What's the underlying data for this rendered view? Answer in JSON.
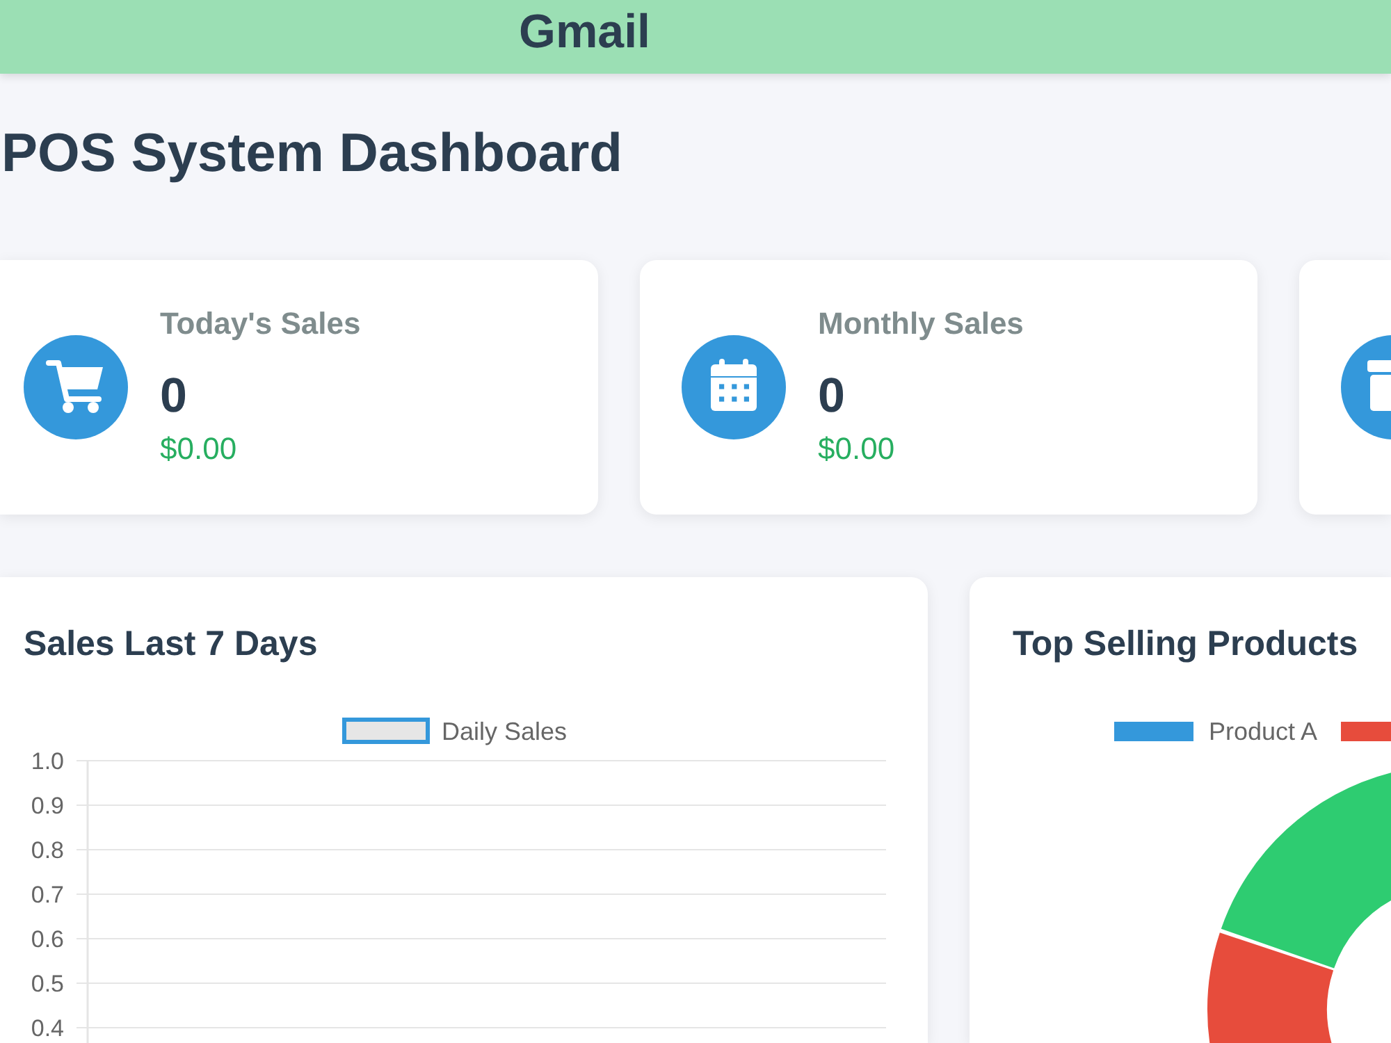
{
  "header": {
    "title": "Gmail"
  },
  "page_title": "POS System Dashboard",
  "stats": [
    {
      "kind": "cart",
      "label": "Today's Sales",
      "count": "0",
      "amount": "$0.00"
    },
    {
      "kind": "calendar",
      "label": "Monthly Sales",
      "count": "0",
      "amount": "$0.00"
    },
    {
      "kind": "box"
    }
  ],
  "sales_chart": {
    "title": "Sales Last 7 Days",
    "chart_data": {
      "type": "line",
      "series": [
        {
          "name": "Daily Sales",
          "color": "#3498db"
        }
      ],
      "ylim": [
        0.4,
        1
      ],
      "yticks": [
        {
          "value": 1,
          "label": "1.0"
        },
        0.9,
        0.8,
        0.7,
        0.6,
        0.5,
        0.4
      ],
      "grid": true
    }
  },
  "products_chart": {
    "title": "Top Selling Products",
    "legend": [
      {
        "label": "Product A",
        "color": "#3498db"
      },
      {
        "color": "#e74c3c"
      }
    ],
    "slices": [
      {
        "color": "#e74c3c"
      },
      {
        "color": "#2ecc71"
      }
    ]
  }
}
